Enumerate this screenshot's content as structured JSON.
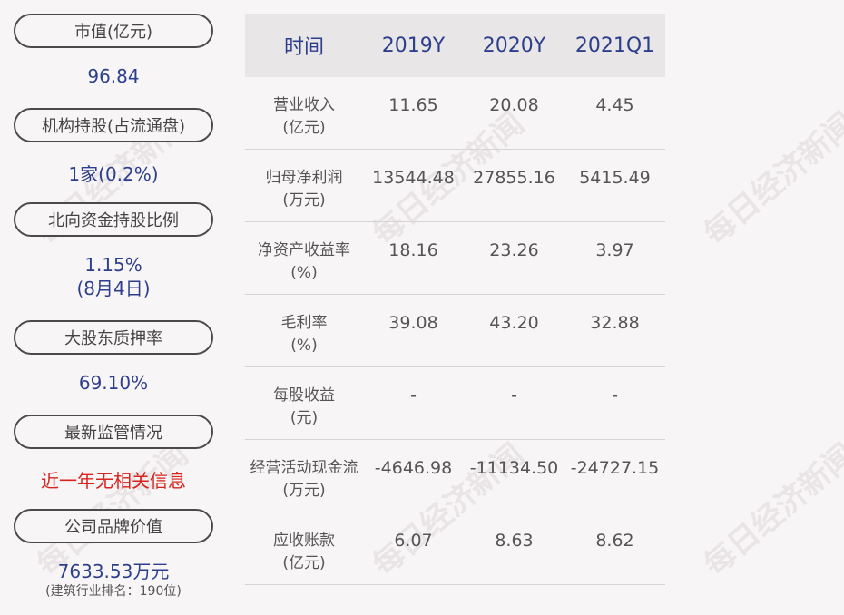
{
  "left_panel": [
    {
      "label": "市值(亿元)",
      "value": "96.84",
      "value_color": "#2d3f8c"
    },
    {
      "label": "机构持股(占流通盘)",
      "value": "1家(0.2%)",
      "value_color": "#2d3f8c"
    },
    {
      "label": "北向资金持股比例",
      "value": "1.15%",
      "value_sub": "(8月4日)",
      "value_color": "#2d3f8c"
    },
    {
      "label": "大股东质押率",
      "value": "69.10%",
      "value_color": "#2d3f8c"
    },
    {
      "label": "最新监管情况",
      "value": "近一年无相关信息",
      "value_color": "#d8241e"
    },
    {
      "label": "公司品牌价值",
      "value": "7633.53万元",
      "value_note": "(建筑行业排名：190位)",
      "value_color": "#2d3f8c"
    }
  ],
  "table": {
    "headers": [
      "时间",
      "2019Y",
      "2020Y",
      "2021Q1"
    ],
    "rows": [
      {
        "label": "营业收入",
        "unit": "(亿元)",
        "values": [
          "11.65",
          "20.08",
          "4.45"
        ]
      },
      {
        "label": "归母净利润",
        "unit": "(万元)",
        "values": [
          "13544.48",
          "27855.16",
          "5415.49"
        ]
      },
      {
        "label": "净资产收益率",
        "unit": "(%)",
        "values": [
          "18.16",
          "23.26",
          "3.97"
        ]
      },
      {
        "label": "毛利率",
        "unit": "(%)",
        "values": [
          "39.08",
          "43.20",
          "32.88"
        ]
      },
      {
        "label": "每股收益",
        "unit": "(元)",
        "values": [
          "-",
          "-",
          "-"
        ]
      },
      {
        "label": "经营活动现金流",
        "unit": "(万元)",
        "values": [
          "-4646.98",
          "-11134.50",
          "-24727.15"
        ]
      },
      {
        "label": "应收账款",
        "unit": "(亿元)",
        "values": [
          "6.07",
          "8.63",
          "8.62"
        ]
      }
    ]
  },
  "watermark": "每日经济新闻"
}
